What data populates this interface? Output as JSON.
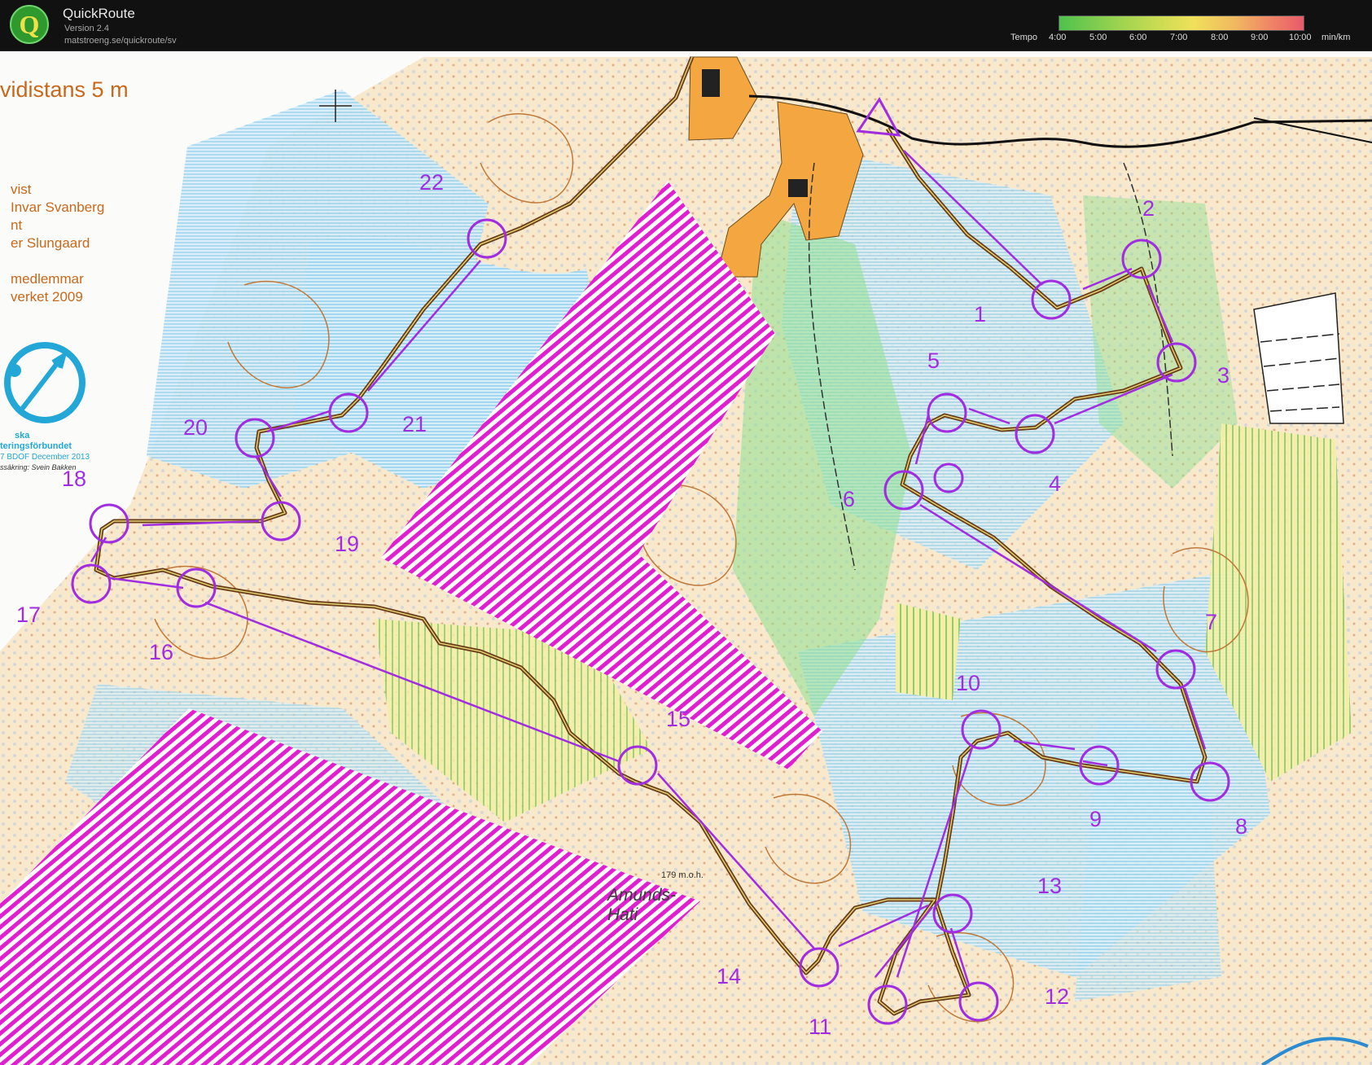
{
  "app": {
    "title": "QuickRoute",
    "version": "Version 2.4",
    "url": "matstroeng.se/quickroute/sv"
  },
  "tempo": {
    "label": "Tempo",
    "ticks": [
      "4:00",
      "5:00",
      "6:00",
      "7:00",
      "8:00",
      "9:00",
      "10:00"
    ],
    "unit": "min/km",
    "colors": [
      "#4ec24e",
      "#c9dc52",
      "#f0e05a",
      "#f0b860",
      "#e85a6a"
    ]
  },
  "map": {
    "colors": {
      "course": "#a12de0",
      "forbidden": "#e020d0",
      "water": "#5ab8e0",
      "contours": "#c07838",
      "field": "#f4a640",
      "forest_green": "#7fd47f",
      "route": "#6a3c1a"
    },
    "legend_text": {
      "title": "vidistans 5 m",
      "line1": "vist",
      "line2": "Invar Svanberg",
      "line3": "nt",
      "line4": "er Slungaard",
      "line5": "medlemmar",
      "line6": "verket 2009",
      "federation1": "ska",
      "federation2": "teringsförbundet",
      "federation3": "7 BDOF December 2013",
      "federation4": "ssäkring: Svein Bakken"
    },
    "place_name": "Amunds-\nHati",
    "place_name_line1": "Amunds-",
    "place_name_line2": "Hati",
    "height_label": "179 m.o.h.",
    "control_labels": [
      "1",
      "2",
      "3",
      "4",
      "5",
      "6",
      "7",
      "8",
      "9",
      "10",
      "11",
      "12",
      "13",
      "14",
      "15",
      "16",
      "17",
      "18",
      "19",
      "20",
      "21",
      "22"
    ]
  }
}
